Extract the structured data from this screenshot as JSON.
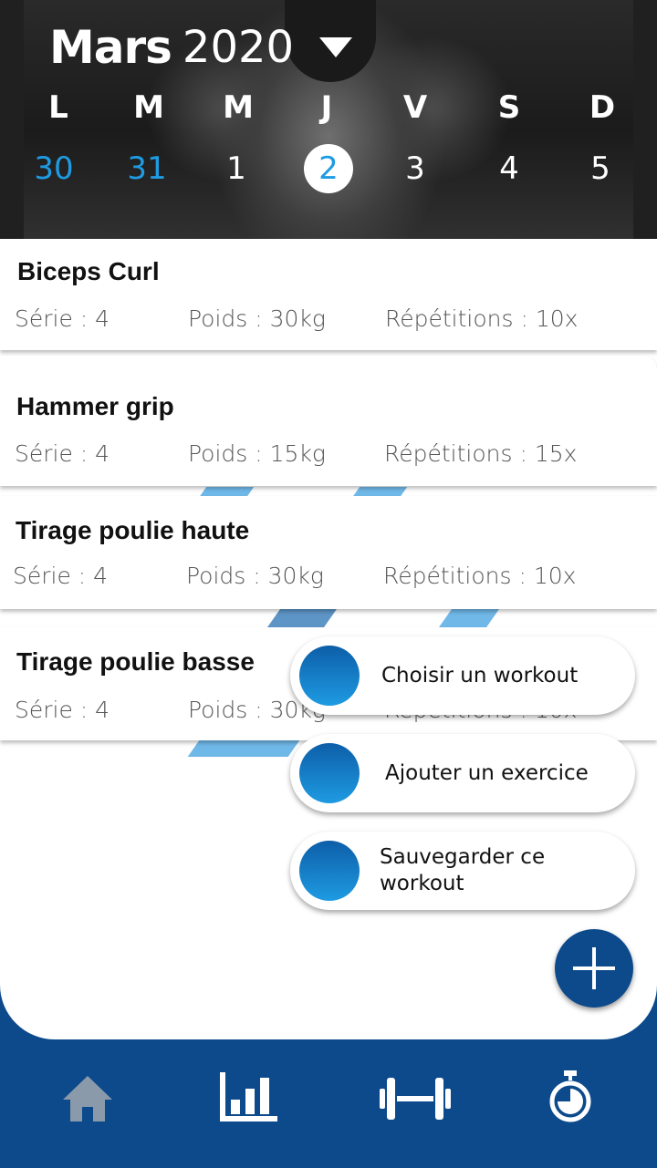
{
  "calendar": {
    "month": "Mars",
    "year": "2020",
    "weekdays": [
      "L",
      "M",
      "M",
      "J",
      "V",
      "S",
      "D"
    ],
    "days": [
      "30",
      "31",
      "1",
      "2",
      "3",
      "4",
      "5"
    ],
    "selected_day": "2"
  },
  "exercises": [
    {
      "name": "Biceps Curl",
      "serie": "Série : 4",
      "poids": "Poids : 30kg",
      "repetitions": "Répétitions : 10x"
    },
    {
      "name": "Hammer grip",
      "serie": "Série : 4",
      "poids": "Poids : 15kg",
      "repetitions": "Répétitions : 15x"
    },
    {
      "name": "Tirage poulie haute",
      "serie": "Série : 4",
      "poids": "Poids : 30kg",
      "repetitions": "Répétitions : 10x"
    },
    {
      "name": "Tirage poulie basse",
      "serie": "Série : 4",
      "poids": "Poids : 30kg",
      "repetitions": "Répétitions : 10x"
    }
  ],
  "fab_menu": {
    "choose_workout": "Choisir un workout",
    "add_exercise": "Ajouter un exercice",
    "save_workout": "Sauvegarder ce workout"
  },
  "nav": {
    "icons": [
      "home-icon",
      "stats-icon",
      "dumbbell-icon",
      "stopwatch-icon"
    ]
  },
  "colors": {
    "primary": "#0d4a8c",
    "accent": "#1e9be2",
    "stripe": "#6fb8e8"
  }
}
